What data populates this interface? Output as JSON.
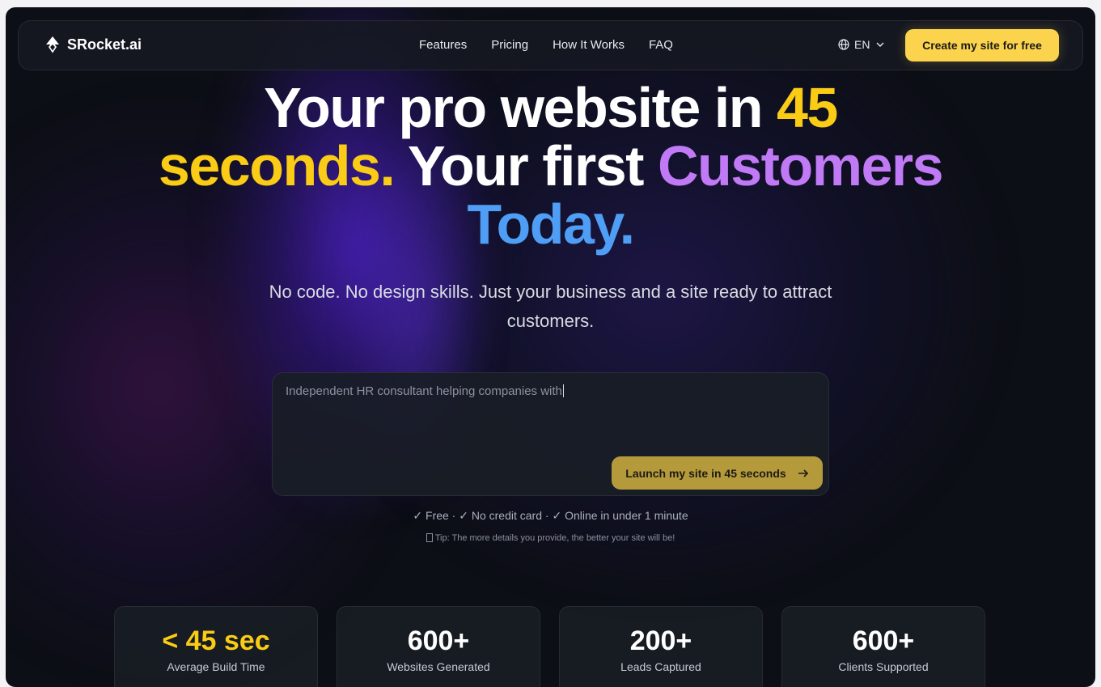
{
  "brand": {
    "name": "SRocket.ai",
    "logo_icon": "rocket-logo-icon"
  },
  "nav": {
    "links": [
      "Features",
      "Pricing",
      "How It Works",
      "FAQ"
    ],
    "language": "EN",
    "cta_label": "Create my site for free"
  },
  "hero": {
    "line1_white": "Your pro website in ",
    "line1_yellow": "45",
    "line2_yellow": "seconds.",
    "line2_white": " Your first ",
    "line2_purple": "Customers",
    "line3_blue": "Today.",
    "subtitle": "No code. No design skills. Just your business and a site ready to attract customers."
  },
  "prompt": {
    "value": "Independent HR consultant helping companies with",
    "button_label": "Launch my site in 45 seconds"
  },
  "perks": "✓ Free · ✓ No credit card · ✓ Online in under 1 minute",
  "tip": "Tip: The more details you provide, the better your site will be!",
  "stats": [
    {
      "value": "< 45 sec",
      "label": "Average Build Time"
    },
    {
      "value": "600+",
      "label": "Websites Generated"
    },
    {
      "value": "200+",
      "label": "Leads Captured"
    },
    {
      "value": "600+",
      "label": "Clients Supported"
    }
  ],
  "colors": {
    "accent_yellow": "#facc15",
    "accent_purple": "#c17af5",
    "accent_blue": "#4f9ef5",
    "cta_yellow": "#fcd34d",
    "launch_button": "#b59a3b",
    "background": "#0d0f16"
  }
}
